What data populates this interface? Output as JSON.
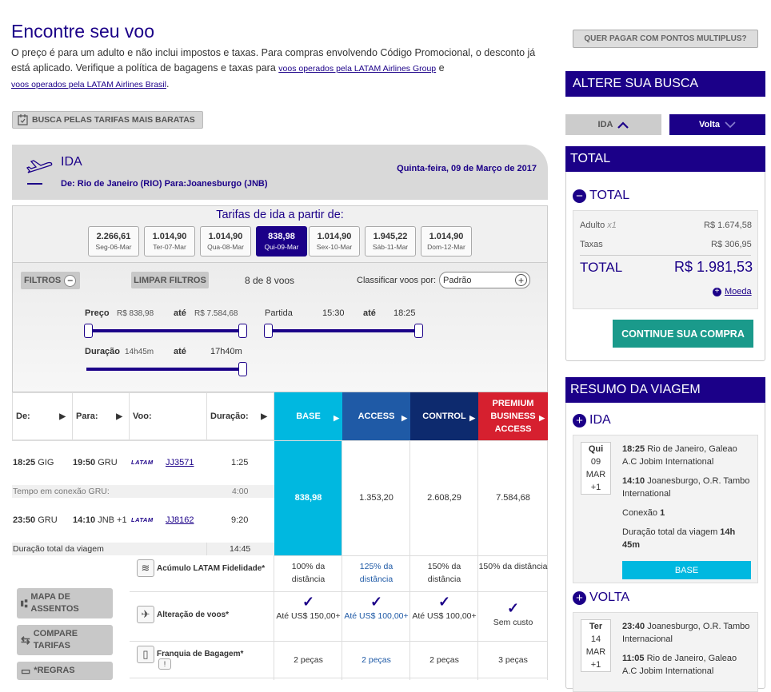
{
  "page": {
    "title": "Encontre seu voo",
    "intro_1": "O preço é para um adulto e não inclui impostos e taxas. Para compras envolvendo Código Promocional, o desconto já está aplicado. Verifique a política de bagagens e taxas para ",
    "intro_link1": "voos operados pela LATAM Airlines Group",
    "intro_2": " e ",
    "intro_link2": "voos operados pela LATAM Airlines Brasil",
    "intro_3": ".",
    "cheap_button": "BUSCA PELAS TARIFAS MAIS BARATAS"
  },
  "ida": {
    "label": "IDA",
    "date": "Quinta-feira, 09 de Março de 2017",
    "route": "De: Rio de Janeiro (RIO) Para:Joanesburgo (JNB)"
  },
  "fares": {
    "title": "Tarifas de ida a partir de:",
    "days": [
      {
        "price": "2.266,61",
        "date": "Seg-06-Mar"
      },
      {
        "price": "1.014,90",
        "date": "Ter-07-Mar"
      },
      {
        "price": "1.014,90",
        "date": "Qua-08-Mar"
      },
      {
        "price": "838,98",
        "date": "Qui-09-Mar"
      },
      {
        "price": "1.014,90",
        "date": "Sex-10-Mar"
      },
      {
        "price": "1.945,22",
        "date": "Sáb-11-Mar"
      },
      {
        "price": "1.014,90",
        "date": "Dom-12-Mar"
      }
    ]
  },
  "filters": {
    "filtros": "FILTROS",
    "limpar": "LIMPAR FILTROS",
    "count": "8 de 8 voos",
    "sort_label": "Classificar voos por:",
    "sort_value": "Padrão",
    "preco_label": "Preço",
    "preco_min": "R$ 838,98",
    "ate": "até",
    "preco_max": "R$ 7.584,68",
    "partida_label": "Partida",
    "partida_min": "15:30",
    "partida_max": "18:25",
    "duracao_label": "Duração",
    "duracao_min": "14h45m",
    "duracao_max": "17h40m"
  },
  "table": {
    "headers": {
      "de": "De:",
      "para": "Para:",
      "voo": "Voo:",
      "duracao": "Duração:"
    },
    "cabins": [
      {
        "name": "BASE",
        "color": "#00b8e0"
      },
      {
        "name": "ACCESS",
        "color": "#1f5aa6"
      },
      {
        "name": "CONTROL",
        "color": "#0d2a6e"
      },
      {
        "name": "PREMIUM BUSINESS ACCESS",
        "color": "#d6202f"
      }
    ],
    "leg1": {
      "dep_time": "18:25",
      "dep": "GIG",
      "arr_time": "19:50",
      "arr": "GRU",
      "airline": "LATAM",
      "flight": "JJ3571",
      "duration": "1:25"
    },
    "conn": {
      "label": "Tempo em conexão GRU:",
      "time": "4:00"
    },
    "leg2": {
      "dep_time": "23:50",
      "dep": "GRU",
      "arr_time": "14:10",
      "arr": "JNB +1",
      "airline": "LATAM",
      "flight": "JJ8162",
      "duration": "9:20"
    },
    "total": {
      "label": "Duração total da viagem",
      "time": "14:45"
    },
    "prices": [
      "838,98",
      "1.353,20",
      "2.608,29",
      "7.584,68"
    ],
    "attrs": [
      {
        "name": "Acúmulo LATAM Fidelidade*",
        "vals": [
          "100% da distância",
          "125% da distância",
          "150% da distância",
          "150% da distância"
        ]
      },
      {
        "name": "Alteração de voos*",
        "vals": [
          "Até US$ 150,00+",
          "Até US$ 100,00+",
          "Até US$ 100,00+",
          "Sem custo"
        ]
      },
      {
        "name": "Franquia de Bagagem*",
        "vals": [
          "2 peças",
          "2 peças",
          "2 peças",
          "3 peças"
        ]
      }
    ],
    "check": "✓"
  },
  "side_buttons": {
    "mapa": "MAPA DE ASSENTOS",
    "compare": "COMPARE TARIFAS",
    "regras": "*REGRAS"
  },
  "right": {
    "pontos": "QUER PAGAR COM PONTOS MULTIPLUS?",
    "altere": "ALTERE SUA BUSCA",
    "ida_toggle": "IDA",
    "volta_toggle": "Volta",
    "total_head": "TOTAL",
    "total_sub": "TOTAL",
    "adulto_label": "Adulto",
    "adulto_mult": "x1",
    "adulto_val": "R$ 1.674,58",
    "taxas_label": "Taxas",
    "taxas_val": "R$ 306,95",
    "total_label": "TOTAL",
    "total_val": "R$ 1.981,53",
    "moeda": "Moeda",
    "continue": "CONTINUE SUA COMPRA",
    "resumo_head": "RESUMO DA VIAGEM",
    "ida_sub": "IDA",
    "ida_card": {
      "dow": "Qui",
      "day": "09",
      "mon": "MAR",
      "plus": "+1"
    },
    "ida_dep_time": "18:25",
    "ida_dep_place": " Rio de Janeiro, Galeao A.C Jobim International",
    "ida_arr_time": "14:10",
    "ida_arr_place": " Joanesburgo, O.R. Tambo International",
    "conexao_label": "Conexão ",
    "conexao_val": "1",
    "duracao_label": "Duração total da viagem ",
    "duracao_val": "14h 45m",
    "base_badge": "BASE",
    "volta_sub": "VOLTA",
    "volta_card": {
      "dow": "Ter",
      "day": "14",
      "mon": "MAR",
      "plus": "+1"
    },
    "volta_dep_time": "23:40",
    "volta_dep_place": " Joanesburgo, O.R. Tambo Internacional",
    "volta_arr_time": "11:05",
    "volta_arr_place": " Rio de Janeiro, Galeao A.C Jobim International"
  }
}
